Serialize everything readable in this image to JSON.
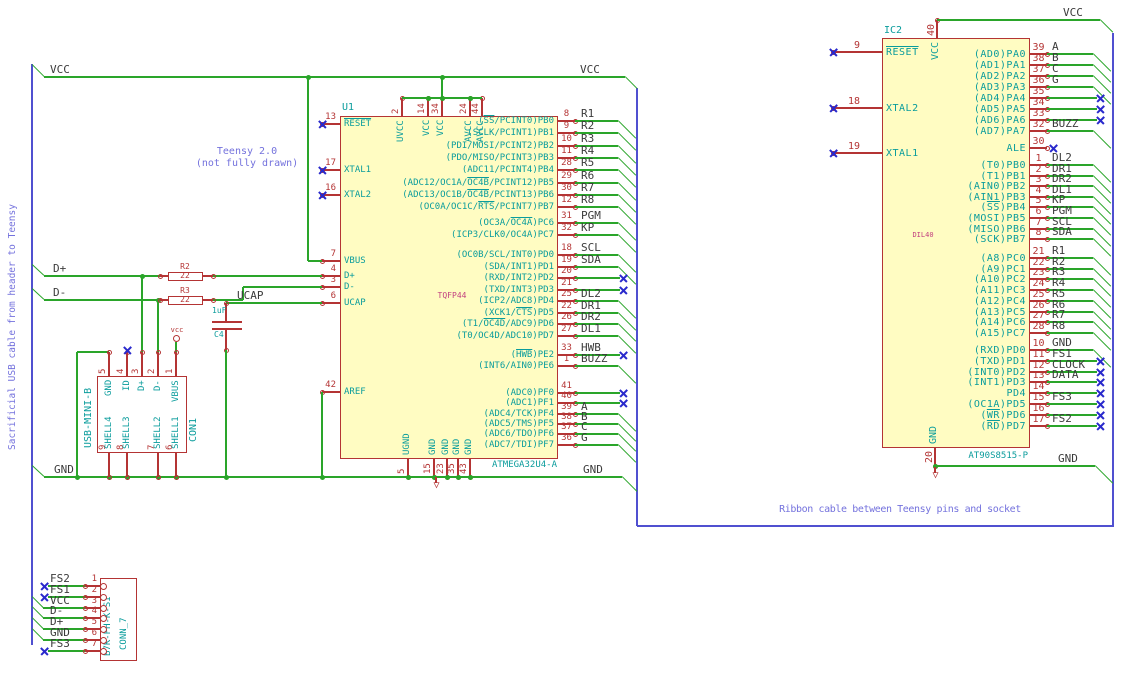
{
  "notes": {
    "teensy_1": "Teensy 2.0",
    "teensy_2": "(not fully drawn)",
    "usb_cable": "Sacrificial USB cable from header to Teensy",
    "ribbon": "Ribbon cable between Teensy pins and socket"
  },
  "labels": {
    "vcc_left": "VCC",
    "vcc_mid": "VCC",
    "vcc_right": "VCC",
    "gnd_left": "GND",
    "gnd_mid": "GND",
    "gnd_right": "GND",
    "dplus": "D+",
    "dminus": "D-",
    "ucap": "UCAP",
    "vcc_flag": "vcc"
  },
  "u1": {
    "ref": "U1",
    "value": "ATMEGA32U4-A",
    "package": "TQFP44",
    "left_pins": [
      {
        "num": "13",
        "name": "~RESET~",
        "nc": true
      },
      {
        "num": "17",
        "name": "XTAL1",
        "nc": true
      },
      {
        "num": "16",
        "name": "XTAL2",
        "nc": true
      },
      {
        "num": "7",
        "name": "VBUS"
      },
      {
        "num": "4",
        "name": "D+"
      },
      {
        "num": "3",
        "name": "D-"
      },
      {
        "num": "6",
        "name": "UCAP"
      },
      {
        "num": "42",
        "name": "AREF"
      }
    ],
    "top_pins": [
      {
        "num": "2",
        "name": "UVCC"
      },
      {
        "num": "14",
        "name": "VCC"
      },
      {
        "num": "34",
        "name": "VCC"
      },
      {
        "num": "24",
        "name": "AVCC"
      },
      {
        "num": "44",
        "name": "AVCC"
      }
    ],
    "bottom_pins": [
      {
        "num": "5",
        "name": "UGND"
      },
      {
        "num": "15",
        "name": "GND"
      },
      {
        "num": "23",
        "name": "GND"
      },
      {
        "num": "35",
        "name": "GND"
      },
      {
        "num": "43",
        "name": "GND"
      }
    ],
    "right_groups": [
      {
        "pins": [
          {
            "num": "8",
            "name": "(~SS~/PCINT0)PB0",
            "label": "R1"
          },
          {
            "num": "9",
            "name": "(SCLK/PCINT1)PB1",
            "label": "R2"
          },
          {
            "num": "10",
            "name": "(PDI/MOSI/PCINT2)PB2",
            "label": "R3"
          },
          {
            "num": "11",
            "name": "(PDO/MISO/PCINT3)PB3",
            "label": "R4"
          },
          {
            "num": "28",
            "name": "(ADC11/PCINT4)PB4",
            "label": "R5"
          },
          {
            "num": "29",
            "name": "(ADC12/OC1A/~OC4B~/PCINT12)PB5",
            "label": "R6"
          },
          {
            "num": "30",
            "name": "(ADC13/OC1B/~OC4B~/PCINT13)PB6",
            "label": "R7"
          },
          {
            "num": "12",
            "name": "(OC0A/OC1C/~RTS~/PCINT7)PB7",
            "label": "R8"
          }
        ]
      },
      {
        "pins": [
          {
            "num": "31",
            "name": "(OC3A/~OC4A~)PC6",
            "label": "PGM"
          },
          {
            "num": "32",
            "name": "(ICP3/CLK0/OC4A)PC7",
            "label": "KP"
          }
        ]
      },
      {
        "pins": [
          {
            "num": "18",
            "name": "(OC0B/SCL/INT0)PD0",
            "label": "SCL"
          },
          {
            "num": "19",
            "name": "(SDA/INT1)PD1",
            "label": "SDA"
          },
          {
            "num": "20",
            "name": "(RXD/INT2)PD2",
            "nc": true
          },
          {
            "num": "21",
            "name": "(TXD/INT3)PD3",
            "nc": true
          },
          {
            "num": "25",
            "name": "(ICP2/ADC8)PD4",
            "label": "DL2"
          },
          {
            "num": "22",
            "name": "(XCK1/~CTS~)PD5",
            "label": "DR1"
          },
          {
            "num": "26",
            "name": "(T1/~OC4D~/ADC9)PD6",
            "label": "DR2"
          },
          {
            "num": "27",
            "name": "(T0/OC4D/ADC10)PD7",
            "label": "DL1"
          }
        ]
      },
      {
        "pins": [
          {
            "num": "33",
            "name": "(~HWB~)PE2",
            "label": "HWB",
            "nc": true
          },
          {
            "num": "1",
            "name": "(INT6/AIN0)PE6",
            "label": "BUZZ"
          }
        ]
      },
      {
        "pins": [
          {
            "num": "41",
            "name": "(ADC0)PF0",
            "nc": true
          },
          {
            "num": "40",
            "name": "(ADC1)PF1",
            "nc": true
          },
          {
            "num": "39",
            "name": "(ADC4/TCK)PF4",
            "label": "A"
          },
          {
            "num": "38",
            "name": "(ADC5/TMS)PF5",
            "label": "B"
          },
          {
            "num": "37",
            "name": "(ADC6/TDO)PF6",
            "label": "C"
          },
          {
            "num": "36",
            "name": "(ADC7/TDI)PF7",
            "label": "G"
          }
        ]
      }
    ]
  },
  "ic2": {
    "ref": "IC2",
    "value": "AT90S8515-P",
    "package": "DIL40",
    "left_pins": [
      {
        "num": "9",
        "name": "~RESET~",
        "nc": true
      },
      {
        "num": "18",
        "name": "XTAL2",
        "nc": true
      },
      {
        "num": "19",
        "name": "XTAL1",
        "nc": true
      }
    ],
    "top_pins": [
      {
        "num": "40",
        "name": "VCC"
      }
    ],
    "bottom_pins": [
      {
        "num": "20",
        "name": "GND"
      }
    ],
    "right_groups": [
      {
        "pins": [
          {
            "num": "39",
            "name": "(AD0)PA0",
            "label": "A"
          },
          {
            "num": "38",
            "name": "(AD1)PA1",
            "label": "B"
          },
          {
            "num": "37",
            "name": "(AD2)PA2",
            "label": "C"
          },
          {
            "num": "36",
            "name": "(AD3)PA3",
            "label": "G"
          },
          {
            "num": "35",
            "name": "(AD4)PA4",
            "nc": true
          },
          {
            "num": "34",
            "name": "(AD5)PA5",
            "nc": true
          },
          {
            "num": "33",
            "name": "(AD6)PA6",
            "nc": true
          },
          {
            "num": "32",
            "name": "(AD7)PA7",
            "label": "BUZZ"
          }
        ]
      },
      {
        "pins": [
          {
            "num": "30",
            "name": "ALE",
            "nc_at_pin": true
          }
        ]
      },
      {
        "pins": [
          {
            "num": "1",
            "name": "(T0)PB0",
            "label": "DL2"
          },
          {
            "num": "2",
            "name": "(T1)PB1",
            "label": "DR1"
          },
          {
            "num": "3",
            "name": "(AIN0)PB2",
            "label": "DR2"
          },
          {
            "num": "4",
            "name": "(AIN1)PB3",
            "label": "DL1"
          },
          {
            "num": "5",
            "name": "(~SS~)PB4",
            "label": "KP"
          },
          {
            "num": "6",
            "name": "(MOSI)PB5",
            "label": "PGM"
          },
          {
            "num": "7",
            "name": "(MISO)PB6",
            "label": "SCL"
          },
          {
            "num": "8",
            "name": "(SCK)PB7",
            "label": "SDA"
          }
        ]
      },
      {
        "pins": [
          {
            "num": "21",
            "name": "(A8)PC0",
            "label": "R1"
          },
          {
            "num": "22",
            "name": "(A9)PC1",
            "label": "R2"
          },
          {
            "num": "23",
            "name": "(A10)PC2",
            "label": "R3"
          },
          {
            "num": "24",
            "name": "(A11)PC3",
            "label": "R4"
          },
          {
            "num": "25",
            "name": "(A12)PC4",
            "label": "R5"
          },
          {
            "num": "26",
            "name": "(A13)PC5",
            "label": "R6"
          },
          {
            "num": "27",
            "name": "(A14)PC6",
            "label": "R7"
          },
          {
            "num": "28",
            "name": "(A15)PC7",
            "label": "R8"
          }
        ]
      },
      {
        "pins": [
          {
            "num": "10",
            "name": "(RXD)PD0",
            "label": "GND"
          },
          {
            "num": "11",
            "name": "(TXD)PD1",
            "label": "FS1",
            "nc": true
          },
          {
            "num": "12",
            "name": "(INT0)PD2",
            "label": "CLOCK",
            "nc": true
          },
          {
            "num": "13",
            "name": "(INT1)PD3",
            "label": "DATA",
            "nc": true
          },
          {
            "num": "14",
            "name": "PD4",
            "nc": true
          },
          {
            "num": "15",
            "name": "(OC1A)PD5",
            "label": "FS3",
            "nc": true
          },
          {
            "num": "16",
            "name": "(~WR~)PD6",
            "nc": true
          },
          {
            "num": "17",
            "name": "(~RD~)PD7",
            "label": "FS2",
            "nc": true
          }
        ]
      }
    ]
  },
  "con1": {
    "ref": "CON1",
    "value": "USB-MINI-B",
    "top_pins": [
      {
        "num": "5",
        "name": "GND"
      },
      {
        "num": "4",
        "name": "ID",
        "nc": true
      },
      {
        "num": "3",
        "name": "D+"
      },
      {
        "num": "2",
        "name": "D-"
      },
      {
        "num": "1",
        "name": "VBUS"
      }
    ],
    "bottom_pins": [
      {
        "num": "9",
        "name": "SHELL4"
      },
      {
        "num": "8",
        "name": "SHELL3"
      },
      {
        "num": "7",
        "name": "SHELL2"
      },
      {
        "num": "6",
        "name": "SHELL1"
      }
    ]
  },
  "conn7": {
    "ref": "CONN_7",
    "value": "B7K-PH-K-S1",
    "pins": [
      {
        "num": "1",
        "label": "FS2",
        "nc": true
      },
      {
        "num": "2",
        "label": "FS1",
        "nc": true
      },
      {
        "num": "3",
        "label": "VCC"
      },
      {
        "num": "4",
        "label": "D-"
      },
      {
        "num": "5",
        "label": "D+"
      },
      {
        "num": "6",
        "label": "GND"
      },
      {
        "num": "7",
        "label": "FS3",
        "n c": false
      }
    ]
  },
  "r2": {
    "ref": "R2",
    "value": "22"
  },
  "r3": {
    "ref": "R3",
    "value": "22"
  },
  "c4": {
    "ref": "C4",
    "value": "1uF"
  },
  "colors": {
    "wire": "#2aa52a",
    "bus": "#5050d0",
    "component": "#b43434",
    "pin_name": "#0a9c9c",
    "field": "#c2407f",
    "label": "#3b3b3b",
    "note": "#7472dd",
    "noconnect": "#2929cc",
    "fill": "#fffcc2"
  }
}
